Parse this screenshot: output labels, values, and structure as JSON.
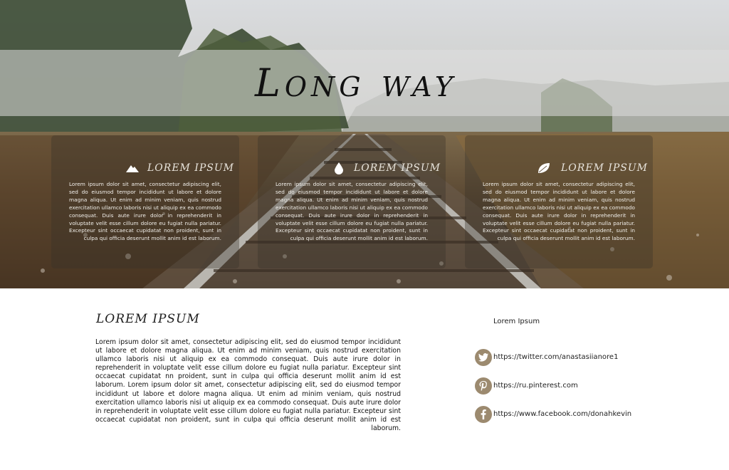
{
  "hero": {
    "title": "Long way",
    "cards": [
      {
        "icon": "mountain-icon",
        "title": "LOREM IPSUM",
        "text": "Lorem ipsum dolor sit amet, consectetur adipiscing elit, sed do eiusmod tempor incididunt ut labore et dolore magna aliqua. Ut enim ad minim veniam, quis nostrud exercitation ullamco laboris nisi ut aliquip ex ea commodo consequat. Duis aute irure dolor in reprehenderit in voluptate velit esse cillum dolore eu fugiat nulla pariatur. Excepteur sint occaecat cupidatat non proident, sunt in culpa qui officia deserunt mollit anim id est laborum."
      },
      {
        "icon": "water-drop-icon",
        "title": "LOREM IPSUM",
        "text": "Lorem ipsum dolor sit amet, consectetur adipiscing elit, sed do eiusmod tempor incididunt ut labore et dolore magna aliqua. Ut enim ad minim veniam, quis nostrud exercitation ullamco laboris nisi ut aliquip ex ea commodo consequat. Duis aute irure dolor in reprehenderit in voluptate velit esse cillum dolore eu fugiat nulla pariatur. Excepteur sint occaecat cupidatat non proident, sunt in culpa qui officia deserunt mollit anim id est laborum."
      },
      {
        "icon": "leaf-icon",
        "title": "LOREM IPSUM",
        "text": "Lorem ipsum dolor sit amet, consectetur adipiscing elit, sed do eiusmod tempor incididunt ut labore et dolore magna aliqua. Ut enim ad minim veniam, quis nostrud exercitation ullamco laboris nisi ut aliquip ex ea commodo consequat. Duis aute irure dolor in reprehenderit in voluptate velit esse cillum dolore eu fugiat nulla pariatur. Excepteur sint occaecat cupidatat non proident, sunt in culpa qui officia deserunt mollit anim id est laborum."
      }
    ]
  },
  "main": {
    "title": "LOREM IPSUM",
    "text": "Lorem ipsum dolor sit amet, consectetur adipiscing elit, sed do eiusmod tempor incididunt ut labore et dolore magna aliqua. Ut enim ad minim veniam, quis nostrud exercitation ullamco laboris nisi ut aliquip ex ea commodo consequat. Duis aute irure dolor in reprehenderit in voluptate velit esse cillum dolore eu fugiat nulla pariatur. Excepteur sint occaecat cupidatat nn proident, sunt in culpa qui officia deserunt mollit anim id est laborum. Lorem ipsum dolor sit amet, consectetur adipiscing elit, sed do eiusmod tempor incididunt ut labore et dolore magna aliqua. Ut enim ad minim veniam, quis nostrud exercitation ullamco laboris nisi ut aliquip ex ea commodo consequat. Duis aute irure dolor in reprehenderit in voluptate velit esse cillum dolore eu fugiat nulla pariatur. Excepteur sint occaecat cupidatat non proident, sunt in culpa qui officia deserunt mollit anim id est laborum."
  },
  "aside": {
    "heading": "Lorem Ipsum",
    "links": [
      {
        "icon": "twitter-icon",
        "url": "https://twitter.com/anastasiianore1"
      },
      {
        "icon": "pinterest-icon",
        "url": "https://ru.pinterest.com"
      },
      {
        "icon": "facebook-icon",
        "url": "https://www.facebook.com/donahkevin"
      }
    ]
  },
  "colors": {
    "social_icon_bg": "#9c8a6f",
    "banner_overlay": "rgba(222,222,222,0.55)",
    "card_overlay": "rgba(55,48,40,0.35)"
  }
}
